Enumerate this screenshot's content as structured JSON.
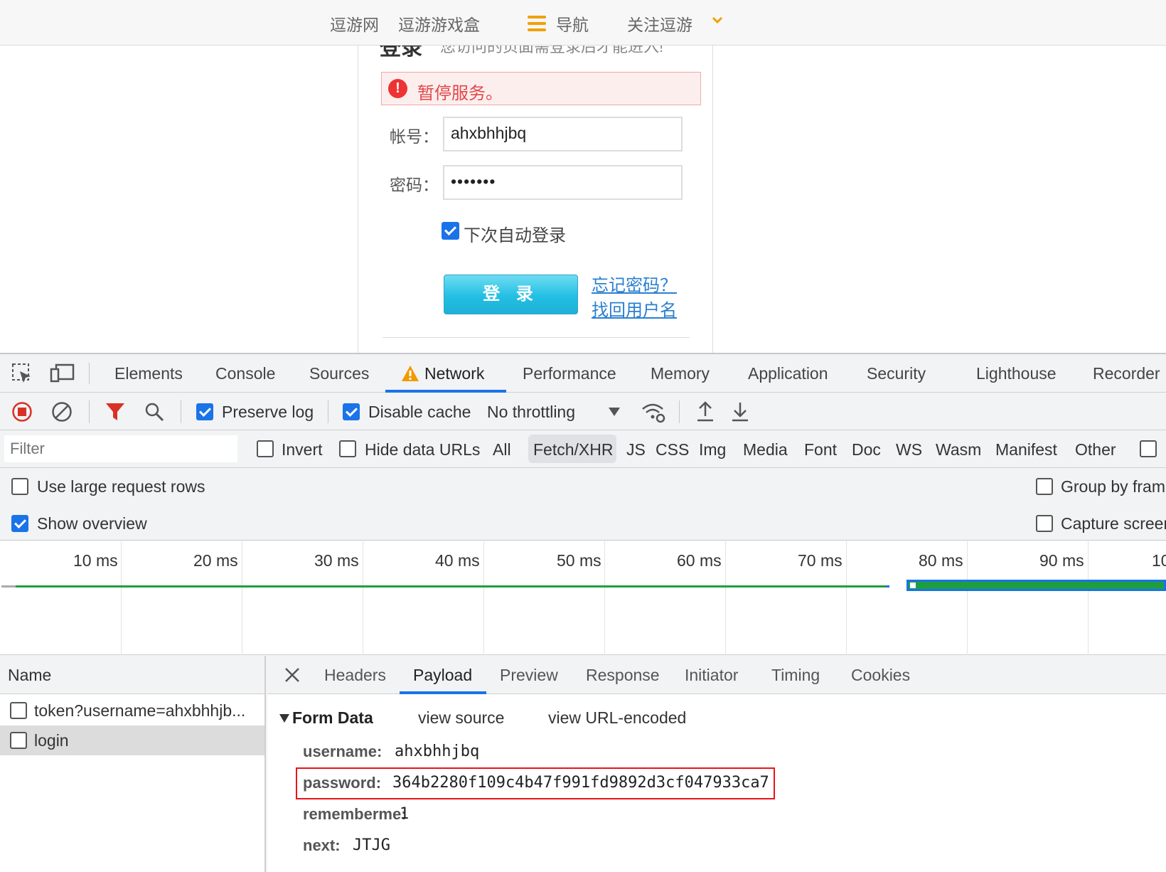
{
  "site": {
    "nav_links": [
      "逗游网",
      "逗游游戏盒"
    ],
    "nav_label": "导航",
    "follow_label": "关注逗游",
    "login_title": "登录",
    "login_desc": "您访问的页面需登录后才能进入!",
    "alert_text": "暂停服务。",
    "account_label": "帐号：",
    "account_value": "ahxbhhjbq",
    "password_label": "密码：",
    "password_masked": "•••••••",
    "remember_label": "下次自动登录",
    "remember_checked": true,
    "login_button": "登 录",
    "forgot_password": "忘记密码？",
    "recover_username": "找回用户名"
  },
  "devtools": {
    "tabs": [
      "Elements",
      "Console",
      "Sources",
      "Network",
      "Performance",
      "Memory",
      "Application",
      "Security",
      "Lighthouse",
      "Recorder"
    ],
    "active_tab": "Network",
    "toolbar": {
      "preserve_log": "Preserve log",
      "disable_cache": "Disable cache",
      "throttling": "No throttling"
    },
    "filter": {
      "placeholder": "Filter",
      "invert": "Invert",
      "hide_data_urls": "Hide data URLs",
      "types": [
        "All",
        "Fetch/XHR",
        "JS",
        "CSS",
        "Img",
        "Media",
        "Font",
        "Doc",
        "WS",
        "Wasm",
        "Manifest",
        "Other"
      ],
      "active_type": "Fetch/XHR"
    },
    "options": {
      "large_rows": "Use large request rows",
      "show_overview": "Show overview",
      "group_by_frame": "Group by fram",
      "capture_screenshots": "Capture screer"
    },
    "timeline_ticks": [
      "10 ms",
      "20 ms",
      "30 ms",
      "40 ms",
      "50 ms",
      "60 ms",
      "70 ms",
      "80 ms",
      "90 ms",
      "10"
    ],
    "name_header": "Name",
    "requests": [
      "token?username=ahxbhhjb...",
      "login"
    ],
    "detail_tabs": [
      "Headers",
      "Payload",
      "Preview",
      "Response",
      "Initiator",
      "Timing",
      "Cookies"
    ],
    "active_detail_tab": "Payload",
    "payload": {
      "section_title": "Form Data",
      "view_source": "view source",
      "view_url_encoded": "view URL-encoded",
      "fields": [
        {
          "key": "username:",
          "value": "ahxbhhjbq"
        },
        {
          "key": "password:",
          "value": "364b2280f109c4b47f991fd9892d3cf047933ca7"
        },
        {
          "key": "rememberme:",
          "value": "1"
        },
        {
          "key": "next:",
          "value": "JTJG"
        }
      ]
    },
    "colors": {
      "accent": "#1a73e8",
      "highlight": "#e8141c",
      "record": "#d93025",
      "timeline_green": "#1e9e3e"
    }
  }
}
